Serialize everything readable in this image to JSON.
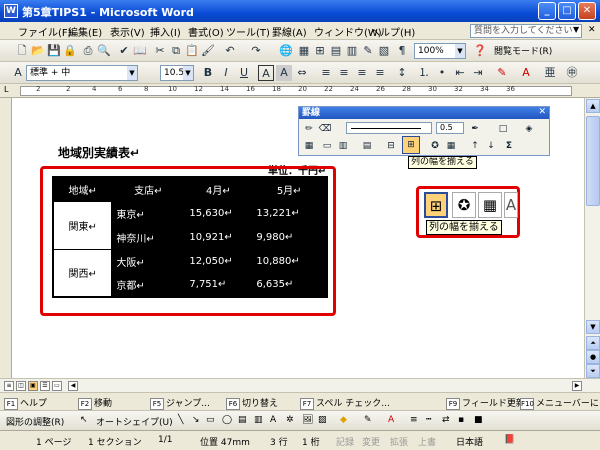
{
  "window": {
    "title": "第5章TIPS1 - Microsoft Word",
    "app_icon": "W"
  },
  "menu": {
    "items": [
      "ファイル(F)",
      "編集(E)",
      "表示(V)",
      "挿入(I)",
      "書式(O)",
      "ツール(T)",
      "罫線(A)",
      "ウィンドウ(W)",
      "ヘルプ(H)"
    ],
    "help_placeholder": "質問を入力してください"
  },
  "standard_toolbar": {
    "zoom": "100%",
    "reading_mode": "閲覧モード(R)"
  },
  "format_toolbar": {
    "style": "標準 + 中",
    "font_size": "10.5",
    "bold": "B",
    "italic": "I",
    "underline": "U",
    "char_border": "A",
    "char_shading": "A"
  },
  "ruler": {
    "numbers": [
      "2",
      "2",
      "4",
      "6",
      "8",
      "10",
      "12",
      "14",
      "16",
      "18",
      "20",
      "22",
      "24",
      "26",
      "28",
      "30",
      "32",
      "34",
      "36"
    ]
  },
  "document": {
    "heading": "地域別実績表↵",
    "unit": "単位：千円↵",
    "table": {
      "headers": [
        "地域↵",
        "支店↵",
        "4月↵",
        "5月↵"
      ],
      "rows": [
        {
          "region": "関東↵",
          "branch": "東京↵",
          "apr": "15,630↵",
          "may": "13,221↵"
        },
        {
          "region": "",
          "branch": "神奈川↵",
          "apr": "10,921↵",
          "may": "9,980↵"
        },
        {
          "region": "関西↵",
          "branch": "大阪↵",
          "apr": "12,050↵",
          "may": "10,880↵"
        },
        {
          "region": "",
          "branch": "京都↵",
          "apr": "7,751↵",
          "may": "6,635↵"
        }
      ]
    }
  },
  "borders_toolbar": {
    "title": "罫線",
    "line_width": "0.5",
    "tooltip": "列の幅を揃える",
    "sum_label": "Σ"
  },
  "zoom_callout": {
    "tooltip": "列の幅を揃える"
  },
  "function_keys": [
    {
      "key": "F1",
      "label": "ヘルプ"
    },
    {
      "key": "F2",
      "label": "移動"
    },
    {
      "key": "F5",
      "label": "ジャンプ..."
    },
    {
      "key": "F6",
      "label": "切り替え"
    },
    {
      "key": "F7",
      "label": "スペル チェック..."
    },
    {
      "key": "F9",
      "label": "フィールド更新"
    },
    {
      "key": "F10",
      "label": "メニューバーに"
    }
  ],
  "drawing_toolbar": {
    "draw_menu": "図形の調整(R)",
    "autoshape": "オートシェイプ(U)"
  },
  "status": {
    "page": "1 ページ",
    "section": "1 セクション",
    "pages": "1/1",
    "position": "位置 47mm",
    "line": "3 行",
    "column": "1 桁",
    "rec": "記録",
    "trk": "変更",
    "ext": "拡張",
    "ovr": "上書",
    "language": "日本語"
  },
  "colors": {
    "title_bar": "#0a4bd6",
    "highlight_frame": "#e00000",
    "table_fill": "#000000"
  }
}
